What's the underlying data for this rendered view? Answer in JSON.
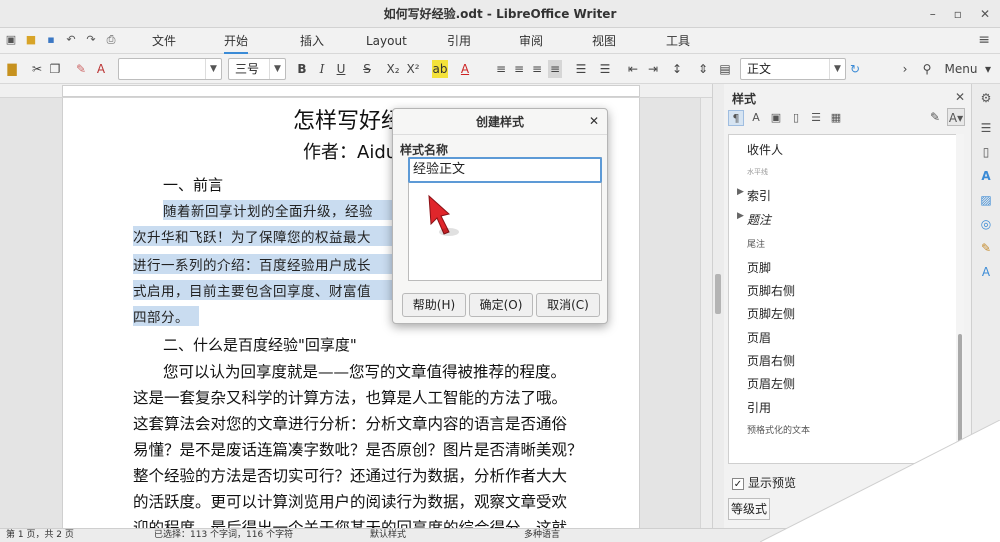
{
  "window": {
    "title": "如何写好经验.odt - LibreOffice Writer",
    "minimize": "–",
    "maximize": "▫",
    "close": "✕"
  },
  "tabs": [
    "文件",
    "开始",
    "插入",
    "Layout",
    "引用",
    "审阅",
    "视图",
    "工具"
  ],
  "active_tab": "开始",
  "toolbar": {
    "font_size": "三号",
    "bold": "B",
    "italic": "I",
    "underline": "U",
    "strike": "S",
    "subscript": "X₂",
    "superscript": "X²",
    "paragraph_style": "正文",
    "menu_label": "Menu"
  },
  "document": {
    "title": "怎样写好经",
    "author": "作者：Aidunc",
    "heading1": "一、前言",
    "para1_lines": [
      "随着新回享计划的全面升级，经验",
      "次升华和飞跃！为了保障您的权益最大",
      "进行一系列的介绍：百度经验用户成长",
      "式启用，目前主要包含回享度、财富值",
      "四部分。"
    ],
    "heading2": "二、什么是百度经验\"回享度\"",
    "para2_lines": [
      "您可以认为回享度就是——您写的文章值得被推荐的程度。",
      "这是一套复杂又科学的计算方法，也算是人工智能的方法了哦。",
      "这套算法会对您的文章进行分析：分析文章内容的语言是否通俗",
      "易懂？是不是废话连篇凑字数吡？是否原创？图片是否清晰美观？",
      "整个经验的方法是否切实可行？还通过行为数据，分析作者大大",
      "的活跃度。更可以计算浏览用户的阅读行为数据，观察文章受欢",
      "迎的程度。最后得出一个关于您某天的回享度的综合得分。这就"
    ]
  },
  "sidebar": {
    "title": "样式",
    "close": "✕",
    "styles": [
      {
        "label": "收件人",
        "type": "normal"
      },
      {
        "label": "水平线",
        "type": "tiny"
      },
      {
        "label": "索引",
        "type": "group"
      },
      {
        "label": "题注",
        "type": "group-italic"
      },
      {
        "label": "尾注",
        "type": "small"
      },
      {
        "label": "页脚",
        "type": "normal"
      },
      {
        "label": "页脚右侧",
        "type": "normal"
      },
      {
        "label": "页脚左侧",
        "type": "normal"
      },
      {
        "label": "页眉",
        "type": "normal"
      },
      {
        "label": "页眉右侧",
        "type": "normal"
      },
      {
        "label": "页眉左侧",
        "type": "normal"
      },
      {
        "label": "引用",
        "type": "normal"
      },
      {
        "label": "预格式化的文本",
        "type": "small"
      }
    ],
    "selected_style": "正文",
    "show_preview_label": "显示预览",
    "hierarchy_label": "等级式"
  },
  "dialog": {
    "title": "创建样式",
    "close": "✕",
    "field_label": "样式名称",
    "field_value": "经验正文",
    "help_button": "帮助(H)",
    "ok_button": "确定(O)",
    "cancel_button": "取消(C)"
  },
  "status": {
    "page": "第 1 页，共 2 页",
    "selection": "已选择：113 个字词，116 个字符",
    "page_style": "默认样式",
    "language": "多种语言"
  },
  "colors": {
    "selection": "#c9dcf0",
    "accent": "#3b8bd6",
    "cursor": "#e0262b"
  }
}
